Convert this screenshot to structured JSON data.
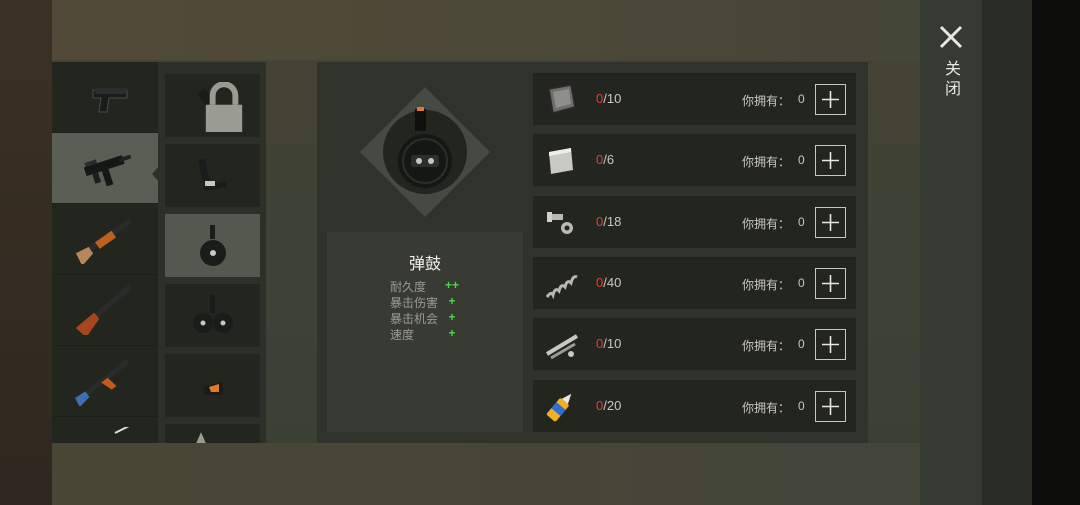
{
  "close": {
    "label": "关闭",
    "icon": "close-icon"
  },
  "weapons": [
    {
      "name": "pistol",
      "icon": "pistol-icon"
    },
    {
      "name": "smg",
      "icon": "smg-icon",
      "selected": true
    },
    {
      "name": "shotgun",
      "icon": "shotgun-icon"
    },
    {
      "name": "double-barrel",
      "icon": "double-barrel-icon"
    },
    {
      "name": "assault-rifle",
      "icon": "assault-rifle-icon"
    },
    {
      "name": "rifle",
      "icon": "rifle-icon"
    }
  ],
  "attachments": [
    {
      "name": "extended-mag",
      "icon": "extended-mag-icon",
      "locked": true
    },
    {
      "name": "stock",
      "icon": "stock-icon"
    },
    {
      "name": "drum-mag",
      "icon": "drum-mag-icon",
      "selected": true
    },
    {
      "name": "double-drum",
      "icon": "double-drum-icon"
    },
    {
      "name": "sight",
      "icon": "sight-icon"
    },
    {
      "name": "starred",
      "icon": "star-icon"
    }
  ],
  "selected_item": {
    "title": "弹鼓",
    "stats": [
      {
        "name": "耐久度",
        "value": "++"
      },
      {
        "name": "暴击伤害",
        "value": "+"
      },
      {
        "name": "暴击机会",
        "value": "+"
      },
      {
        "name": "速度",
        "value": "+"
      }
    ]
  },
  "materials": {
    "own_label": "你拥有：",
    "items": [
      {
        "icon": "metal-plate-icon",
        "have": "0",
        "need": "/10",
        "owned": "0"
      },
      {
        "icon": "steel-sheet-icon",
        "have": "0",
        "need": "/6",
        "owned": "0"
      },
      {
        "icon": "bolt-nut-icon",
        "have": "0",
        "need": "/18",
        "owned": "0"
      },
      {
        "icon": "spring-icon",
        "have": "0",
        "need": "/40",
        "owned": "0"
      },
      {
        "icon": "pipes-icon",
        "have": "0",
        "need": "/10",
        "owned": "0"
      },
      {
        "icon": "glue-icon",
        "have": "0",
        "need": "/20",
        "owned": "0"
      }
    ]
  },
  "colors": {
    "accent_red": "#e33b3b",
    "stat_green": "#4fd24f"
  }
}
